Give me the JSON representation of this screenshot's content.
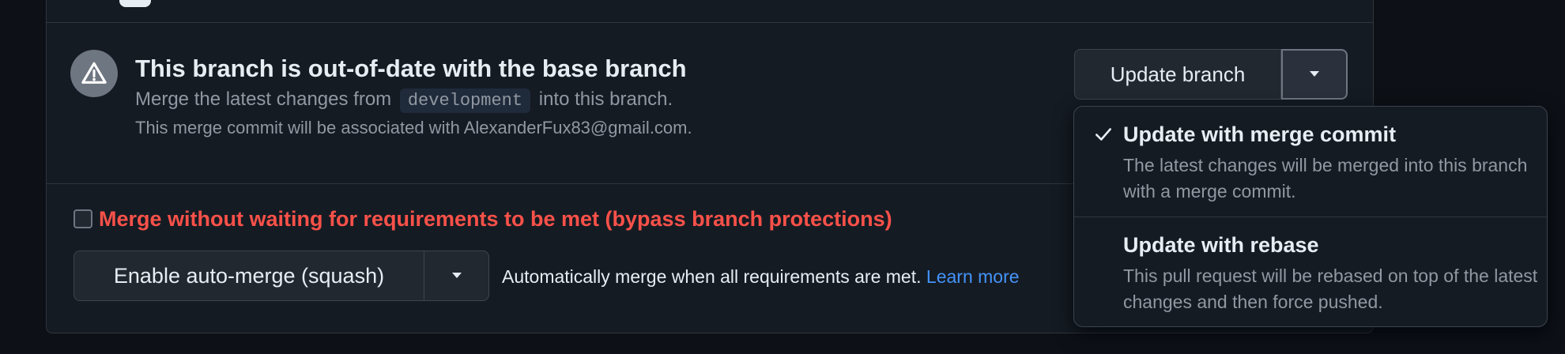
{
  "warning": {
    "icon": "alert-icon",
    "title": "This branch is out-of-date with the base branch",
    "line1_prefix": "Merge the latest changes from",
    "base_branch": "development",
    "line1_suffix": "into this branch.",
    "line2": "This merge commit will be associated with AlexanderFux83@gmail.com."
  },
  "update_branch": {
    "label": "Update branch",
    "caret_icon": "triangle-down-icon"
  },
  "update_menu": {
    "items": [
      {
        "title": "Update with merge commit",
        "description": "The latest changes will be merged into this branch with a merge commit.",
        "selected": true
      },
      {
        "title": "Update with rebase",
        "description": "This pull request will be rebased on top of the latest changes and then force pushed.",
        "selected": false
      }
    ]
  },
  "merge": {
    "bypass_label": "Merge without waiting for requirements to be met (bypass branch protections)",
    "bypass_checked": false,
    "automerge_label": "Enable auto-merge (squash)",
    "automerge_hint": "Automatically merge when all requirements are met.",
    "learn_more": "Learn more"
  },
  "colors": {
    "background": "#0d1117",
    "panel": "#151b23",
    "danger": "#f85149",
    "link": "#4493f8",
    "muted_text": "#9198a1"
  }
}
